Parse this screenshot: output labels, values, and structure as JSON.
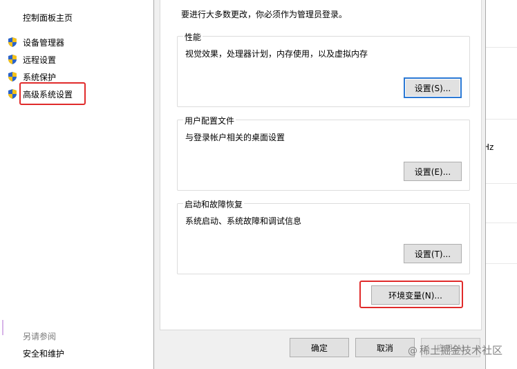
{
  "left_pane": {
    "home_link": "控制面板主页",
    "links": [
      {
        "label": "设备管理器"
      },
      {
        "label": "远程设置"
      },
      {
        "label": "系统保护"
      },
      {
        "label": "高级系统设置"
      }
    ],
    "see_also_label": "另请参阅",
    "security_link": "安全和维护"
  },
  "right_strip": {
    "unit_text": "Hz"
  },
  "dialog": {
    "admin_note": "要进行大多数更改，你必须作为管理员登录。",
    "performance": {
      "title": "性能",
      "description": "视觉效果，处理器计划，内存使用，以及虚拟内存",
      "button": "设置(S)..."
    },
    "user_profiles": {
      "title": "用户配置文件",
      "description": "与登录帐户相关的桌面设置",
      "button": "设置(E)..."
    },
    "startup_recovery": {
      "title": "启动和故障恢复",
      "description": "系统启动、系统故障和调试信息",
      "button": "设置(T)..."
    },
    "env_vars_button": "环境变量(N)...",
    "ok_button": "确定",
    "cancel_button": "取消",
    "apply_button": "应用(A)"
  },
  "watermark": {
    "text": "稀土掘金技术社区"
  },
  "colors": {
    "highlight_red": "#e02a2a",
    "focus_blue": "#2a78d4",
    "dialog_bg": "#f0f0f0",
    "button_bg": "#e1e1e1"
  },
  "icons": {
    "shield": "uac-shield-icon"
  }
}
